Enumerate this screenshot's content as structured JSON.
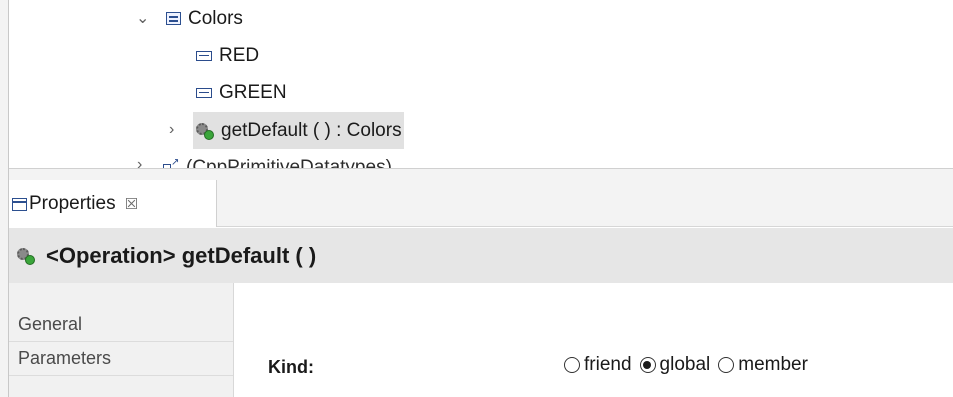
{
  "tree": {
    "items": [
      {
        "label": "Colors",
        "icon": "enumeration-icon",
        "twisty": "expanded"
      },
      {
        "label": "RED",
        "icon": "enum-literal-icon"
      },
      {
        "label": "GREEN",
        "icon": "enum-literal-icon"
      },
      {
        "label": "getDefault ( ) : Colors",
        "icon": "operation-icon",
        "twisty": "collapsed",
        "selected": true
      },
      {
        "label": "(CppPrimitiveDatatypes)",
        "icon": "package-import-icon",
        "twisty": "collapsed"
      }
    ]
  },
  "properties": {
    "tab_label": "Properties",
    "tab_close": "☒",
    "header_title": "<Operation> getDefault ( )",
    "nav": [
      {
        "label": "General"
      },
      {
        "label": "Parameters"
      }
    ],
    "kind": {
      "label": "Kind:",
      "options": [
        {
          "label": "friend",
          "checked": false
        },
        {
          "label": "global",
          "checked": true
        },
        {
          "label": "member",
          "checked": false
        }
      ]
    }
  }
}
